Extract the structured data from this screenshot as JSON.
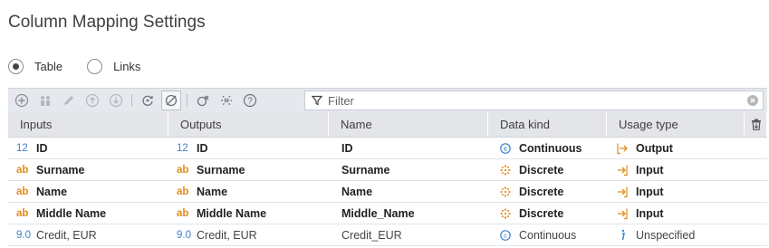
{
  "title": "Column Mapping Settings",
  "modes": [
    {
      "label": "Table",
      "selected": true
    },
    {
      "label": "Links",
      "selected": false
    }
  ],
  "filter": {
    "placeholder": "Filter"
  },
  "toolbar": {
    "buttons": [
      "add-icon",
      "group-icon",
      "edit-icon",
      "move-up-icon",
      "move-down-icon",
      "refresh-icon",
      "sync-icon",
      "unlink-icon",
      "split-icon",
      "help-icon"
    ]
  },
  "columns": [
    "Inputs",
    "Outputs",
    "Name",
    "Data kind",
    "Usage type"
  ],
  "rows": [
    {
      "in_type": "12",
      "input": "ID",
      "out_type": "12",
      "output": "ID",
      "name": "ID",
      "kind": "Continuous",
      "usage": "Output",
      "emphasis": true
    },
    {
      "in_type": "ab",
      "input": "Surname",
      "out_type": "ab",
      "output": "Surname",
      "name": "Surname",
      "kind": "Discrete",
      "usage": "Input",
      "emphasis": true
    },
    {
      "in_type": "ab",
      "input": "Name",
      "out_type": "ab",
      "output": "Name",
      "name": "Name",
      "kind": "Discrete",
      "usage": "Input",
      "emphasis": true
    },
    {
      "in_type": "ab",
      "input": "Middle Name",
      "out_type": "ab",
      "output": "Middle Name",
      "name": "Middle_Name",
      "kind": "Discrete",
      "usage": "Input",
      "emphasis": true
    },
    {
      "in_type": "9.0",
      "input": "Credit, EUR",
      "out_type": "9.0",
      "output": "Credit, EUR",
      "name": "Credit_EUR",
      "kind": "Continuous",
      "usage": "Unspecified",
      "emphasis": false
    }
  ],
  "colors": {
    "accent_blue": "#3c82c8",
    "accent_orange": "#e08c1a",
    "header_bg": "#e3e5e8",
    "toolbar_bg": "#e5e8ec"
  }
}
